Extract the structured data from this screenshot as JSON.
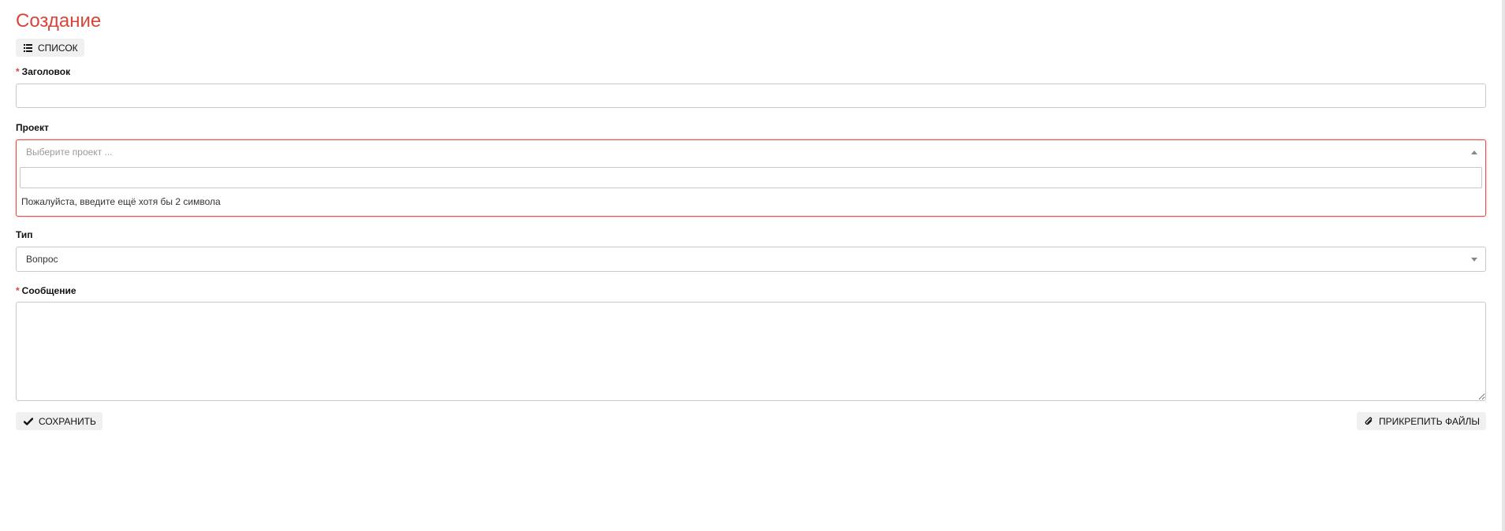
{
  "page": {
    "title": "Создание"
  },
  "toolbar": {
    "list_label": "СПИСОК"
  },
  "form": {
    "title_field": {
      "required_mark": "*",
      "label": "Заголовок",
      "value": ""
    },
    "project_field": {
      "label": "Проект",
      "placeholder": "Выберите проект ...",
      "search_value": "",
      "hint": "Пожалуйста, введите ещё хотя бы 2 символа"
    },
    "type_field": {
      "label": "Тип",
      "selected": "Вопрос"
    },
    "message_field": {
      "required_mark": "*",
      "label": "Сообщение",
      "value": ""
    }
  },
  "actions": {
    "save_label": "СОХРАНИТЬ",
    "attach_label": "ПРИКРЕПИТЬ ФАЙЛЫ"
  },
  "colors": {
    "accent": "#d9453a",
    "error_border": "#e04d4d",
    "button_bg": "#f0f0f0"
  }
}
